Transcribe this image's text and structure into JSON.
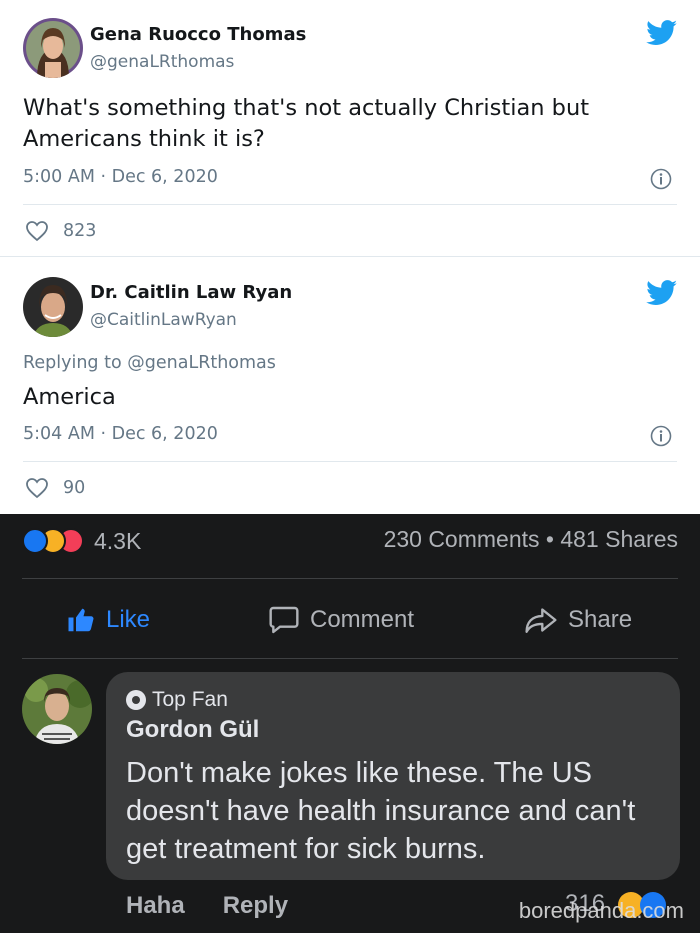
{
  "tweets": [
    {
      "name": "Gena Ruocco Thomas",
      "handle": "@genaLRthomas",
      "text": "What's something that's not actually Christian but Americans think it is?",
      "time": "5:00 AM · Dec 6, 2020",
      "likes": "823",
      "avatar": "avatar-woman",
      "icons": [
        "twitter-bird-icon",
        "info-icon",
        "heart-icon"
      ]
    },
    {
      "name": "Dr. Caitlin Law Ryan",
      "handle": "@CaitlinLawRyan",
      "reply_label": "Replying to",
      "reply_to": "@genaLRthomas",
      "text": "America",
      "time": "5:04 AM · Dec 6, 2020",
      "likes": "90",
      "avatar": "avatar-woman-smiling",
      "icons": [
        "twitter-bird-icon",
        "info-icon",
        "heart-icon"
      ]
    }
  ],
  "facebook": {
    "reaction_count": "4.3K",
    "stats": "230 Comments • 481 Shares",
    "actions": {
      "like": "Like",
      "comment": "Comment",
      "share": "Share"
    },
    "comment": {
      "badge": "Top Fan",
      "author": "Gordon Gül",
      "text": "Don't make jokes like these. The US doesn't have health insurance and can't get treatment for sick burns.",
      "haha": "Haha",
      "reply": "Reply",
      "reaction_count": "316"
    },
    "watermark": "boredpanda.com"
  },
  "colors": {
    "twitter_blue": "#1da1f2",
    "fb_background": "#18191a",
    "fb_bubble": "#3a3b3c",
    "fb_like_blue": "#2d88ff",
    "muted_text": "#657786"
  }
}
